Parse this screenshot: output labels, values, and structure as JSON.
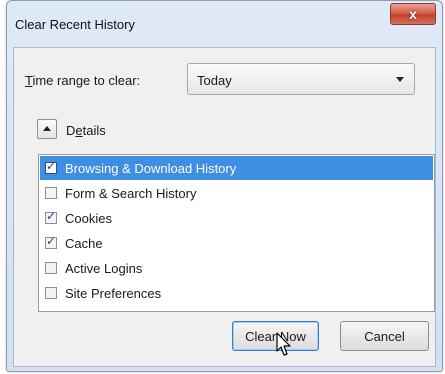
{
  "window": {
    "title": "Clear Recent History",
    "close_label": "x"
  },
  "time_range": {
    "label_prefix": "",
    "label_mnemonic": "T",
    "label_rest": "ime range to clear:",
    "selected_option": "Today"
  },
  "details": {
    "label_start": "D",
    "label_mnemonic": "e",
    "label_rest": "tails",
    "expanded": true
  },
  "history_items": [
    {
      "label": "Browsing & Download History",
      "checked": true,
      "selected": true
    },
    {
      "label": "Form & Search History",
      "checked": false,
      "selected": false
    },
    {
      "label": "Cookies",
      "checked": true,
      "selected": false
    },
    {
      "label": "Cache",
      "checked": true,
      "selected": false
    },
    {
      "label": "Active Logins",
      "checked": false,
      "selected": false
    },
    {
      "label": "Site Preferences",
      "checked": false,
      "selected": false
    }
  ],
  "buttons": {
    "clear_now": "Clear Now",
    "cancel": "Cancel"
  },
  "colors": {
    "selection": "#3e8ee4",
    "close_button": "#c2402a"
  }
}
